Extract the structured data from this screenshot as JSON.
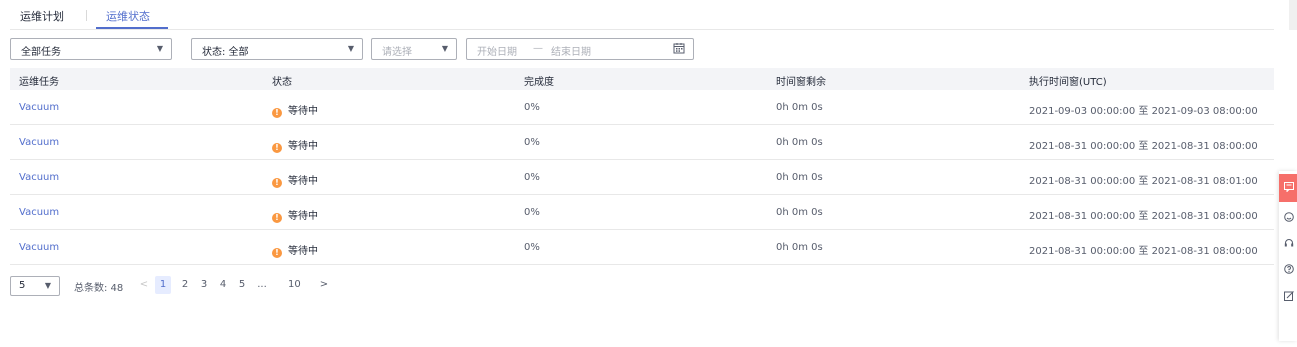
{
  "tabs": [
    {
      "label": "运维计划"
    },
    {
      "label": "运维状态"
    }
  ],
  "filters": {
    "task": "全部任务",
    "status": "状态: 全部",
    "select_placeholder": "请选择",
    "start_date_placeholder": "开始日期",
    "date_separator": "—",
    "end_date_placeholder": "结束日期"
  },
  "table": {
    "headers": [
      "运维任务",
      "状态",
      "完成度",
      "时间窗剩余",
      "执行时间窗(UTC)"
    ],
    "rows": [
      {
        "task": "Vacuum",
        "status": "等待中",
        "progress": "0%",
        "remaining": "0h 0m 0s",
        "window": "2021-09-03 00:00:00 至 2021-09-03 08:00:00"
      },
      {
        "task": "Vacuum",
        "status": "等待中",
        "progress": "0%",
        "remaining": "0h 0m 0s",
        "window": "2021-08-31 00:00:00 至 2021-08-31 08:00:00"
      },
      {
        "task": "Vacuum",
        "status": "等待中",
        "progress": "0%",
        "remaining": "0h 0m 0s",
        "window": "2021-08-31 00:00:00 至 2021-08-31 08:01:00"
      },
      {
        "task": "Vacuum",
        "status": "等待中",
        "progress": "0%",
        "remaining": "0h 0m 0s",
        "window": "2021-08-31 00:00:00 至 2021-08-31 08:00:00"
      },
      {
        "task": "Vacuum",
        "status": "等待中",
        "progress": "0%",
        "remaining": "0h 0m 0s",
        "window": "2021-08-31 00:00:00 至 2021-08-31 08:00:00"
      }
    ]
  },
  "pagination": {
    "page_size": "5",
    "total": "总条数: 48",
    "prev": "<",
    "pages": [
      "1",
      "2",
      "3",
      "4",
      "5",
      "...",
      "10"
    ],
    "next": ">"
  },
  "colors": {
    "accent": "#526ecc",
    "warning": "#fa9841",
    "feedback": "#f66f6a"
  },
  "sidebar_icons": [
    "feedback-icon",
    "smile-icon",
    "headset-icon",
    "help-icon",
    "edit-icon"
  ]
}
